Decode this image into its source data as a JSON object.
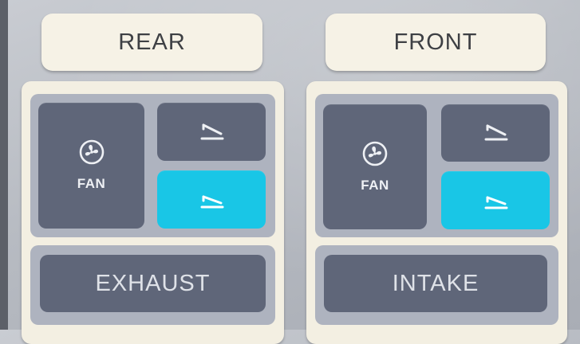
{
  "colors": {
    "title_bg": "#f6f2e6",
    "panel_bg": "#f3efe2",
    "tile": "#5f6679",
    "tile_active": "#19c6e6",
    "grid_bg": "#aeb3bf"
  },
  "rear": {
    "title": "REAR",
    "fan_label": "FAN",
    "fan_icon": "fan-icon",
    "flap_up_icon": "flap-open-icon",
    "flap_down_icon": "flap-closed-icon",
    "active_flap": "closed",
    "action_label": "EXHAUST"
  },
  "front": {
    "title": "FRONT",
    "fan_label": "FAN",
    "fan_icon": "fan-icon",
    "flap_up_icon": "flap-open-icon",
    "flap_down_icon": "flap-closed-icon",
    "active_flap": "closed",
    "action_label": "INTAKE"
  }
}
